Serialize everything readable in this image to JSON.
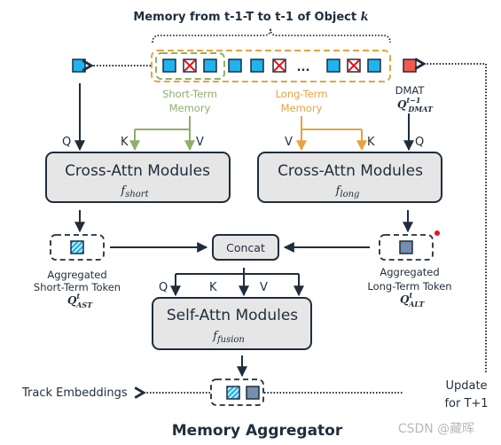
{
  "title": "Memory from t-1-T to t-1 of Object k",
  "title_main": "Memory from t-1-T to t-1 of Object ",
  "title_var": "k",
  "memory": {
    "ellipsis": "...",
    "short_term_label": [
      "Short-Term",
      "Memory"
    ],
    "long_term_label": [
      "Long-Term",
      "Memory"
    ],
    "dmat_label": "DMAT",
    "dmat_symbol": {
      "base": "Q",
      "sup": "t−1",
      "sub": "DMAT"
    },
    "tokens": [
      "valid",
      "invalid",
      "valid",
      "valid",
      "valid",
      "invalid",
      "valid",
      "invalid",
      "valid"
    ]
  },
  "cross_short": {
    "title": "Cross-Attn Modules",
    "fn": {
      "base": "f",
      "sub": "short"
    },
    "inputs": [
      "Q",
      "K",
      "V"
    ]
  },
  "cross_long": {
    "title": "Cross-Attn Modules",
    "fn": {
      "base": "f",
      "sub": "long"
    },
    "inputs": [
      "V",
      "K",
      "Q"
    ]
  },
  "concat": "Concat",
  "agg_short": {
    "label": [
      "Aggregated",
      "Short-Term Token"
    ],
    "symbol": {
      "base": "Q",
      "sup": "t",
      "sub": "AST"
    }
  },
  "agg_long": {
    "label": [
      "Aggregated",
      "Long-Term Token"
    ],
    "symbol": {
      "base": "Q",
      "sup": "t",
      "sub": "ALT"
    }
  },
  "self_attn": {
    "title": "Self-Attn Modules",
    "fn": {
      "base": "f",
      "sub": "fusion"
    },
    "inputs": [
      "Q",
      "K",
      "V"
    ]
  },
  "track_embeddings": "Track Embeddings",
  "update": [
    "Update",
    "for T+1"
  ],
  "caption": "Memory Aggregator",
  "watermark": "CSDN @藏晖",
  "colors": {
    "token_blue": "#1fb3f0",
    "token_red": "#f05a4f",
    "short_green": "#8faf6b",
    "long_orange": "#e8a33d",
    "module_fill": "#e6e6e6",
    "text_dark": "#1f2d3d"
  }
}
